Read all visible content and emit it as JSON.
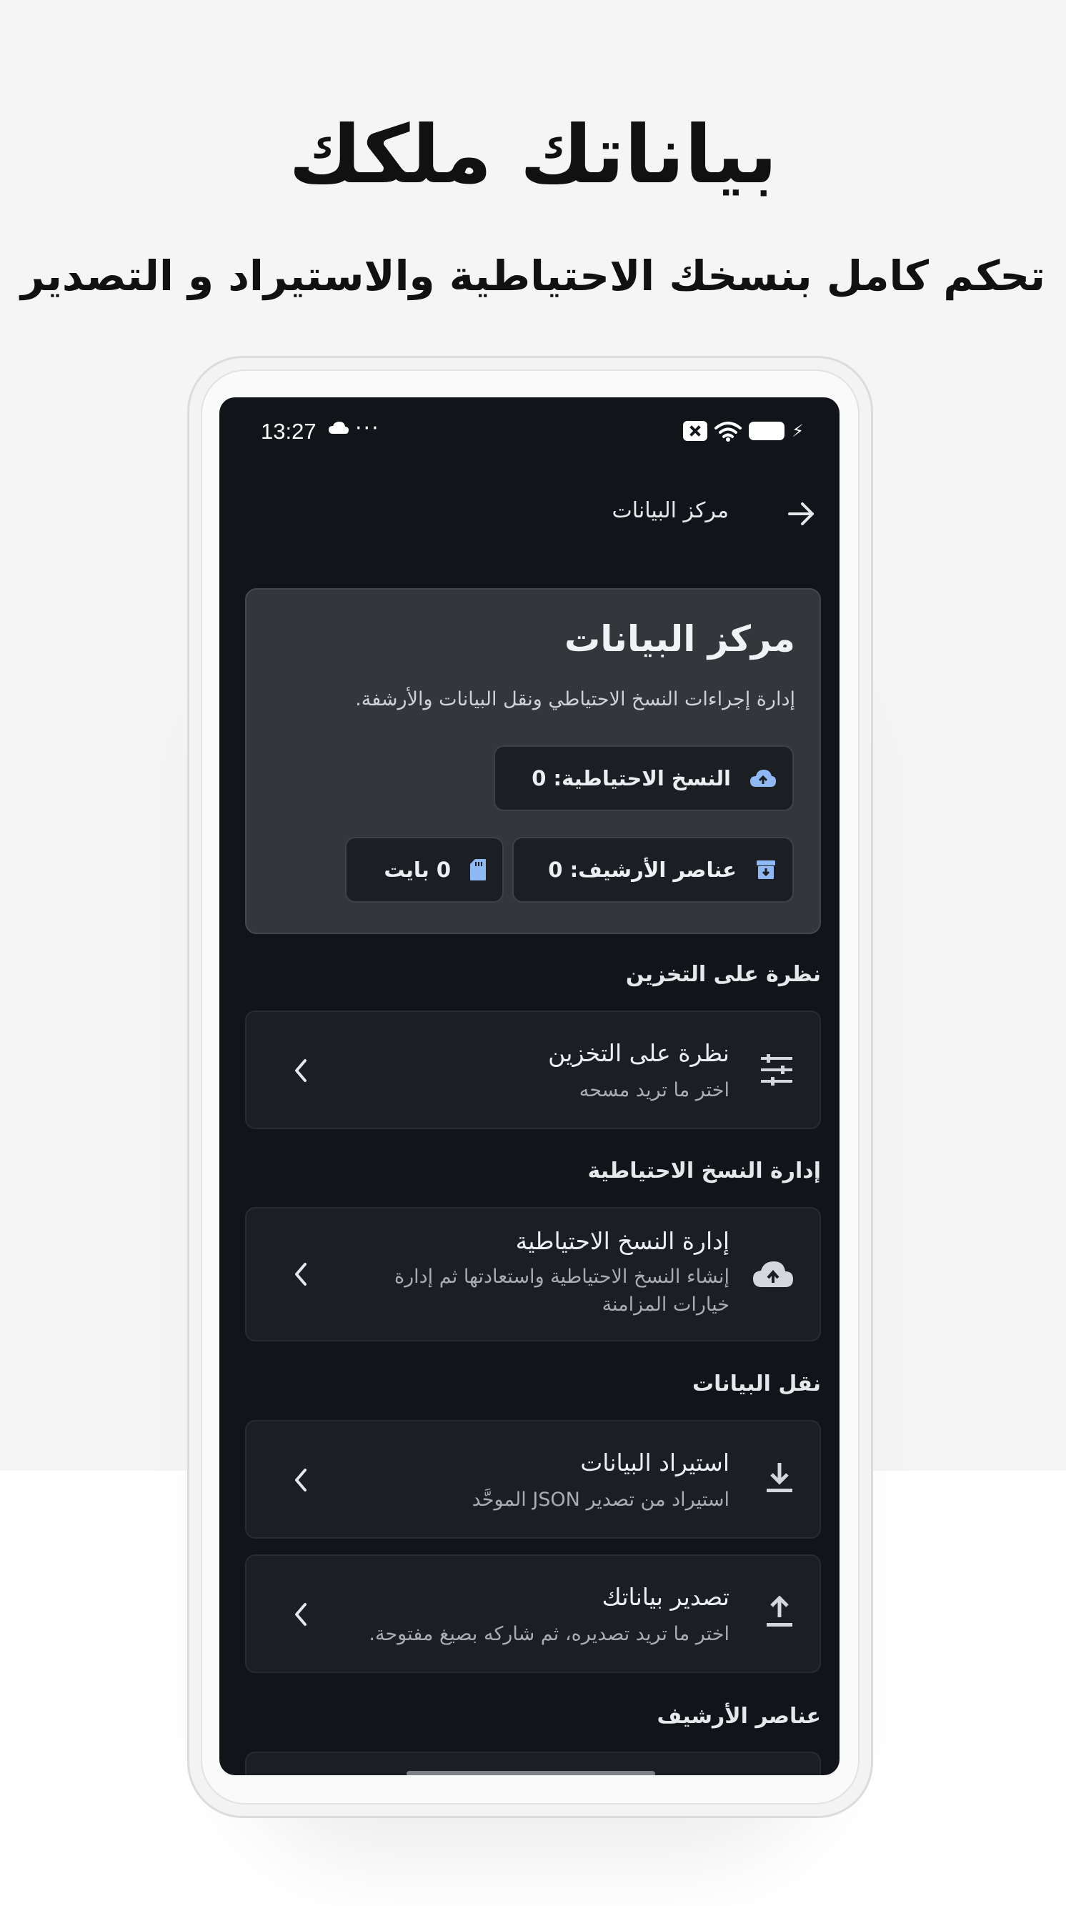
{
  "hero": {
    "title": "بياناتك ملكك",
    "subtitle": "تحكم كامل بنسخك الاحتياطية والاستيراد و التصدير"
  },
  "status_bar": {
    "time": "13:27",
    "icons": [
      "cloud-icon",
      "more-dots-icon",
      "close-box-icon",
      "wifi-icon",
      "battery-icon",
      "charging-bolt-icon"
    ]
  },
  "app_bar": {
    "title": "مركز البيانات",
    "back_icon": "arrow-right-icon"
  },
  "overview": {
    "title": "مركز البيانات",
    "description": "إدارة إجراءات النسخ الاحتياطي ونقل البيانات والأرشفة.",
    "chips": [
      {
        "label": "النسخ الاحتياطية: 0",
        "icon": "cloud-upload-icon"
      },
      {
        "label": "عناصر الأرشيف: 0",
        "icon": "archive-icon"
      },
      {
        "label": "0 بايت",
        "icon": "sd-card-icon"
      }
    ]
  },
  "sections": {
    "storage": {
      "header": "نظرة على التخزين",
      "item": {
        "title": "نظرة على التخزين",
        "subtitle": "اختر ما تريد مسحه",
        "icon": "tune-sliders-icon"
      }
    },
    "backup": {
      "header": "إدارة النسخ الاحتياطية",
      "item": {
        "title": "إدارة النسخ الاحتياطية",
        "subtitle": "إنشاء النسخ الاحتياطية واستعادتها ثم إدارة خيارات المزامنة",
        "icon": "cloud-upload-icon"
      }
    },
    "transfer": {
      "header": "نقل البيانات",
      "import": {
        "title": "استيراد البيانات",
        "subtitle": "استيراد من تصدير JSON الموحَّد",
        "icon": "download-icon"
      },
      "export": {
        "title": "تصدير بياناتك",
        "subtitle": "اختر ما تريد تصديره، ثم شاركه بصيغ مفتوحة.",
        "icon": "upload-icon"
      }
    },
    "archive": {
      "header": "عناصر الأرشيف"
    }
  },
  "colors": {
    "screen_bg": "#111418",
    "card_bg": "#1b1e24",
    "overview_bg": "#34363b",
    "accent_blue": "#8fb8f5",
    "icon_gray": "#d5d7dc"
  }
}
